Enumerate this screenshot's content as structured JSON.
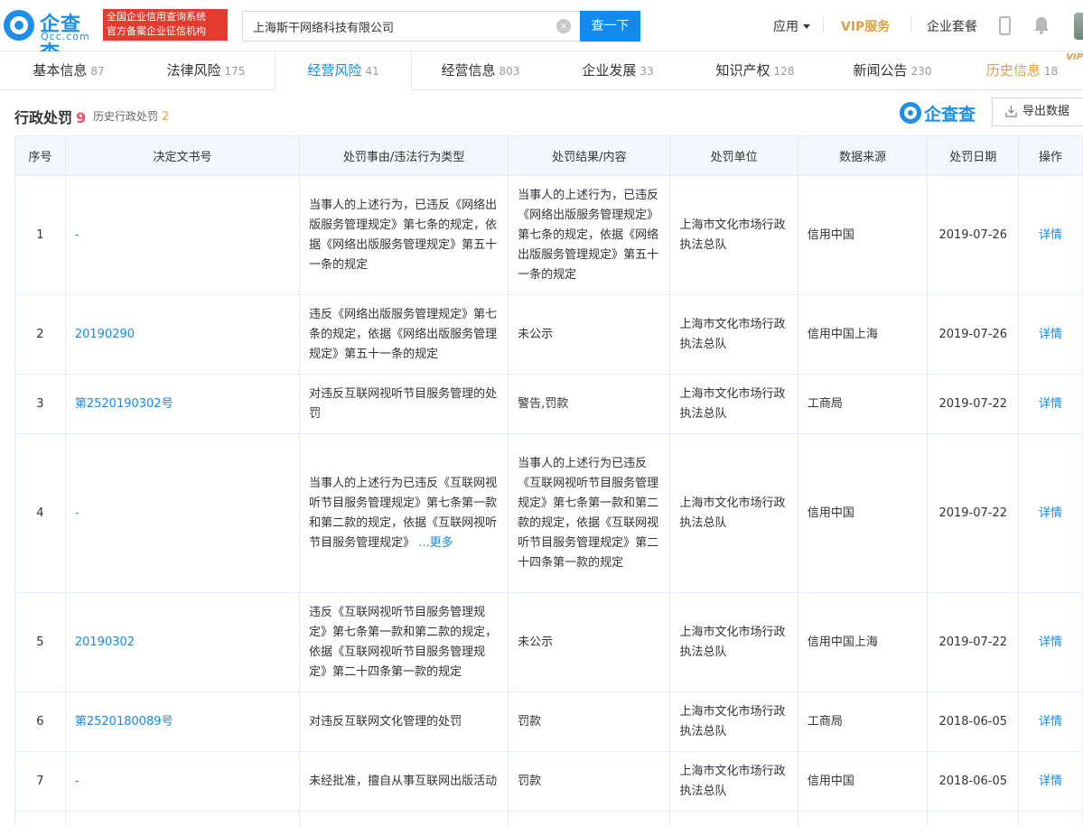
{
  "header": {
    "logo_cn": "企查查",
    "logo_en": "Qcc.com",
    "badge_line1": "全国企业信用查询系统",
    "badge_line2": "官方备案企业征信机构",
    "search_value": "上海斯干网络科技有限公司",
    "search_button": "查一下",
    "nav_app": "应用",
    "nav_vip": "VIP服务",
    "nav_package": "企业套餐"
  },
  "tabs": [
    {
      "label": "基本信息",
      "count": "87"
    },
    {
      "label": "法律风险",
      "count": "175"
    },
    {
      "label": "经营风险",
      "count": "41"
    },
    {
      "label": "经营信息",
      "count": "803"
    },
    {
      "label": "企业发展",
      "count": "33"
    },
    {
      "label": "知识产权",
      "count": "128"
    },
    {
      "label": "新闻公告",
      "count": "230"
    },
    {
      "label": "历史信息",
      "count": "18",
      "tag": "VIP"
    }
  ],
  "section": {
    "title": "行政处罚",
    "count": "9",
    "history_label": "历史行政处罚",
    "history_count": "2",
    "watermark": "企查查",
    "export_label": "导出数据"
  },
  "table": {
    "headers": [
      "序号",
      "决定文书号",
      "处罚事由/违法行为类型",
      "处罚结果/内容",
      "处罚单位",
      "数据来源",
      "处罚日期",
      "操作"
    ],
    "rows": [
      {
        "no": "1",
        "doc": "-",
        "reason": "当事人的上述行为，已违反《网络出版服务管理规定》第七条的规定，依据《网络出版服务管理规定》第五十一条的规定",
        "result": "当事人的上述行为，已违反《网络出版服务管理规定》第七条的规定，依据《网络出版服务管理规定》第五十一条的规定",
        "unit": "上海市文化市场行政执法总队",
        "source": "信用中国",
        "date": "2019-07-26",
        "action": "详情"
      },
      {
        "no": "2",
        "doc": "20190290",
        "reason": "违反《网络出版服务管理规定》第七条的规定，依据《网络出版服务管理规定》第五十一条的规定",
        "result": "未公示",
        "unit": "上海市文化市场行政执法总队",
        "source": "信用中国上海",
        "date": "2019-07-26",
        "action": "详情"
      },
      {
        "no": "3",
        "doc": "第2520190302号",
        "reason": "对违反互联网视听节目服务管理的处罚",
        "result": "警告,罚款",
        "unit": "上海市文化市场行政执法总队",
        "source": "工商局",
        "date": "2019-07-22",
        "action": "详情"
      },
      {
        "no": "4",
        "doc": "-",
        "reason": "当事人的上述行为已违反《互联网视听节目服务管理规定》第七条第一款和第二款的规定，依据《互联网视听节目服务管理规定》",
        "reason_more": "...更多",
        "result": "当事人的上述行为已违反《互联网视听节目服务管理规定》第七条第一款和第二款的规定，依据《互联网视听节目服务管理规定》第二十四条第一款的规定",
        "unit": "上海市文化市场行政执法总队",
        "source": "信用中国",
        "date": "2019-07-22",
        "action": "详情"
      },
      {
        "no": "5",
        "doc": "20190302",
        "reason": "违反《互联网视听节目服务管理规定》第七条第一款和第二款的规定，依据《互联网视听节目服务管理规定》第二十四条第一款的规定",
        "result": "未公示",
        "unit": "上海市文化市场行政执法总队",
        "source": "信用中国上海",
        "date": "2019-07-22",
        "action": "详情"
      },
      {
        "no": "6",
        "doc": "第2520180089号",
        "reason": "对违反互联网文化管理的处罚",
        "result": "罚款",
        "unit": "上海市文化市场行政执法总队",
        "source": "工商局",
        "date": "2018-06-05",
        "action": "详情"
      },
      {
        "no": "7",
        "doc": "-",
        "reason": "未经批准，擅自从事互联网出版活动",
        "result": "罚款",
        "unit": "上海市文化市场行政执法总队",
        "source": "信用中国",
        "date": "2018-06-05",
        "action": "详情"
      }
    ]
  }
}
